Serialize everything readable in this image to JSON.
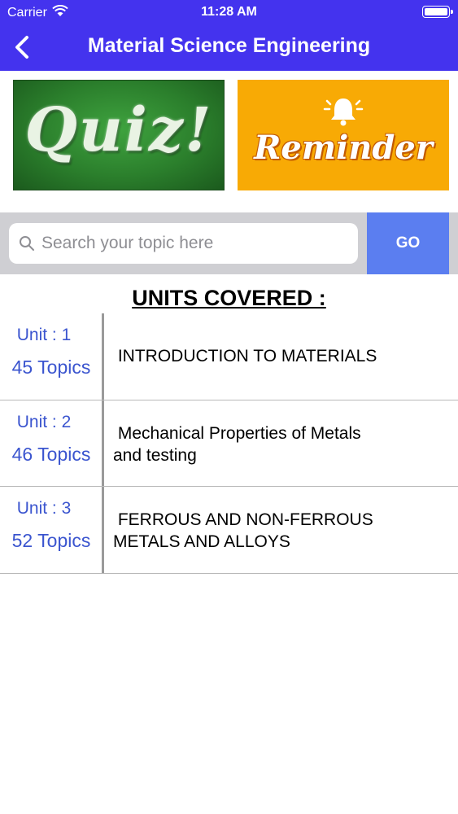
{
  "status_bar": {
    "carrier": "Carrier",
    "time": "11:28 AM"
  },
  "nav": {
    "title": "Material Science Engineering",
    "back_icon": "chevron-left-icon"
  },
  "banners": {
    "quiz": "Quiz!",
    "reminder": "Reminder",
    "reminder_icon": "bell-icon"
  },
  "search": {
    "placeholder": "Search your topic here",
    "value": "",
    "go_label": "GO"
  },
  "heading": "UNITS COVERED :",
  "units": [
    {
      "unit": "Unit : 1",
      "topics": "45 Topics",
      "title": " INTRODUCTION TO MATERIALS"
    },
    {
      "unit": "Unit : 2",
      "topics": "46 Topics",
      "title": " Mechanical Properties of Metals\nand testing"
    },
    {
      "unit": "Unit : 3",
      "topics": "52 Topics",
      "title": " FERROUS AND NON-FERROUS\nMETALS AND ALLOYS"
    }
  ],
  "colors": {
    "brand": "#4433ee",
    "go_button": "#5b7ef0",
    "unit_text": "#3b55cf",
    "quiz_green": "#2b7f2c",
    "reminder_orange": "#f8aa05"
  }
}
